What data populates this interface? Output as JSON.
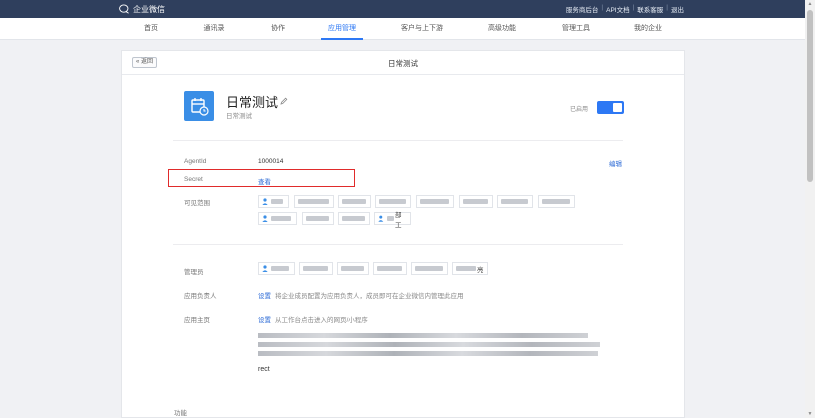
{
  "topbar": {
    "brand": "企业微信",
    "links": [
      "服务商后台",
      "API文档",
      "联系客服",
      "退出"
    ]
  },
  "nav": {
    "items": [
      {
        "label": "首页",
        "active": false
      },
      {
        "label": "通讯录",
        "active": false
      },
      {
        "label": "协作",
        "active": false
      },
      {
        "label": "应用管理",
        "active": true
      },
      {
        "label": "客户与上下游",
        "active": false
      },
      {
        "label": "高级功能",
        "active": false
      },
      {
        "label": "管理工具",
        "active": false
      },
      {
        "label": "我的企业",
        "active": false
      }
    ]
  },
  "card": {
    "back_label": "« 返回",
    "title": "日常测试"
  },
  "app": {
    "name": "日常测试",
    "subtitle": "日常测试",
    "enabled_label": "已启用",
    "enabled": true,
    "icon": "calendar-icon",
    "edit_icon": "pencil-icon"
  },
  "fields": {
    "agentid_label": "AgentId",
    "agentid_value": "1000014",
    "edit_link": "编辑",
    "secret_label": "Secret",
    "secret_action": "查看",
    "scope_label": "可见范围",
    "scope_chip_suffixes": [
      "",
      "",
      "",
      "",
      "",
      "",
      "",
      "",
      "",
      "",
      "",
      "",
      "",
      "部工"
    ],
    "admin_label": "管理员",
    "admin_chip_suffixes": [
      "",
      "",
      "",
      "",
      "",
      "亮"
    ],
    "owner_label": "应用负责人",
    "owner_action": "设置",
    "owner_desc": "将企业成员配置为应用负责人，成员即可在企业微信内管理此应用",
    "homepage_label": "应用主页",
    "homepage_action": "设置",
    "homepage_desc": "从工作台点击进入的网页/小程序",
    "homepage_url_tail": "rect",
    "func_label": "功能"
  },
  "colors": {
    "topbar": "#2f3f5d",
    "accent": "#2d78f4",
    "highlight_box": "#e02b2b"
  }
}
